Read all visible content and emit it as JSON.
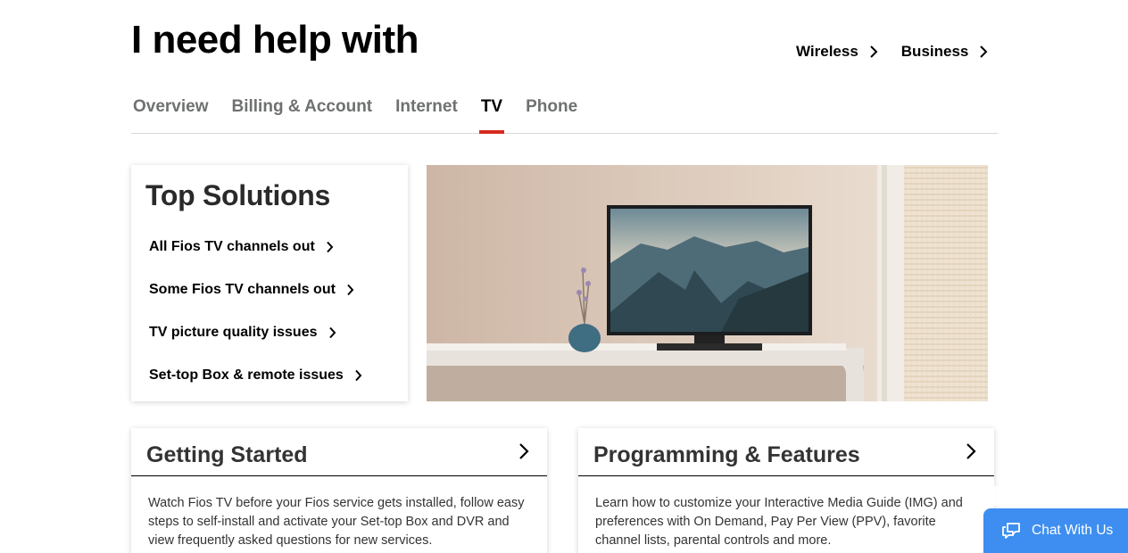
{
  "header": {
    "title": "I need help with",
    "links": [
      {
        "label": "Wireless"
      },
      {
        "label": "Business"
      }
    ]
  },
  "tabs": [
    {
      "label": "Overview",
      "active": false
    },
    {
      "label": "Billing & Account",
      "active": false
    },
    {
      "label": "Internet",
      "active": false
    },
    {
      "label": "TV",
      "active": true
    },
    {
      "label": "Phone",
      "active": false
    }
  ],
  "top_solutions": {
    "title": "Top Solutions",
    "items": [
      {
        "label": "All Fios TV channels out"
      },
      {
        "label": "Some Fios TV channels out"
      },
      {
        "label": "TV picture quality issues"
      },
      {
        "label": "Set-top Box & remote issues"
      }
    ]
  },
  "cards": [
    {
      "title": "Getting Started",
      "description": "Watch Fios TV before your Fios service gets installed, follow easy steps to self-install and activate your Set-top Box and DVR and view frequently asked questions for new services."
    },
    {
      "title": "Programming & Features",
      "description": "Learn how to customize your Interactive Media Guide (IMG) and preferences with On Demand, Pay Per View (PPV), favorite channel lists, parental controls and more."
    }
  ],
  "chat": {
    "label": "Chat With Us"
  },
  "colors": {
    "accent": "#d52b1e",
    "chat": "#3d8ef0"
  }
}
